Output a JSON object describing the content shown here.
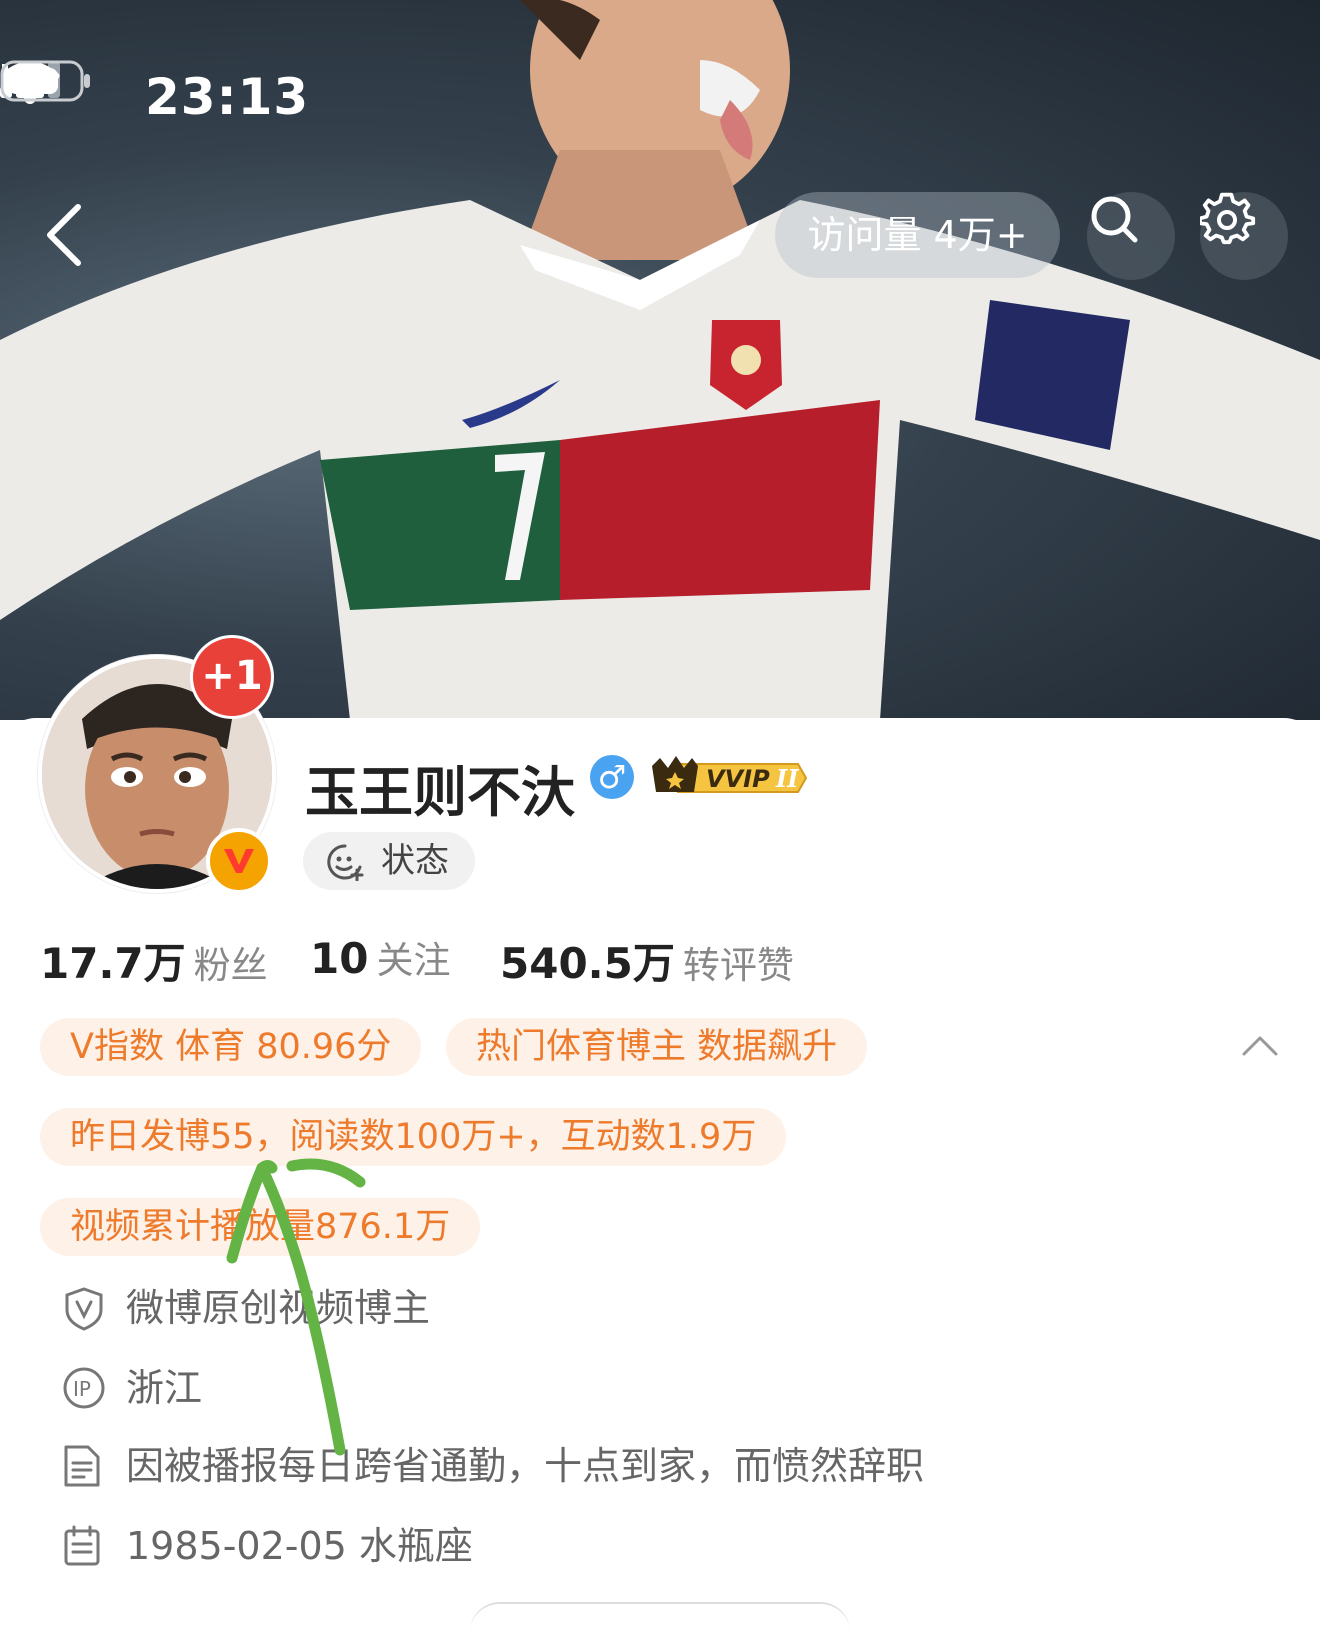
{
  "status_bar": {
    "time": "23:13"
  },
  "header": {
    "visits_label": "访问量 4万+"
  },
  "profile": {
    "username": "玉王则不汏",
    "gender_symbol": "♂",
    "vvip_label": "VVIP",
    "avatar_badge": "+1",
    "status_label": "状态"
  },
  "stats": {
    "followers_value": "17.7万",
    "followers_label": "粉丝",
    "following_value": "10",
    "following_label": "关注",
    "likes_value": "540.5万",
    "likes_label": "转评赞"
  },
  "tags": {
    "v_index": "V指数 体育 80.96分",
    "hot_blogger": "热门体育博主 数据飙升",
    "yesterday": "昨日发博55，阅读数100万+，互动数1.9万",
    "video_plays": "视频累计播放量876.1万"
  },
  "info": {
    "certification": "微博原创视频博主",
    "ip_location": "浙江",
    "bio": "因被播报每日跨省通勤，十点到家，而愤然辞职",
    "birthday": "1985-02-05 水瓶座"
  },
  "colors": {
    "tag_text": "#ee7a2c",
    "tag_bg": "#fdf1e8",
    "annotation_green": "#63b345"
  }
}
